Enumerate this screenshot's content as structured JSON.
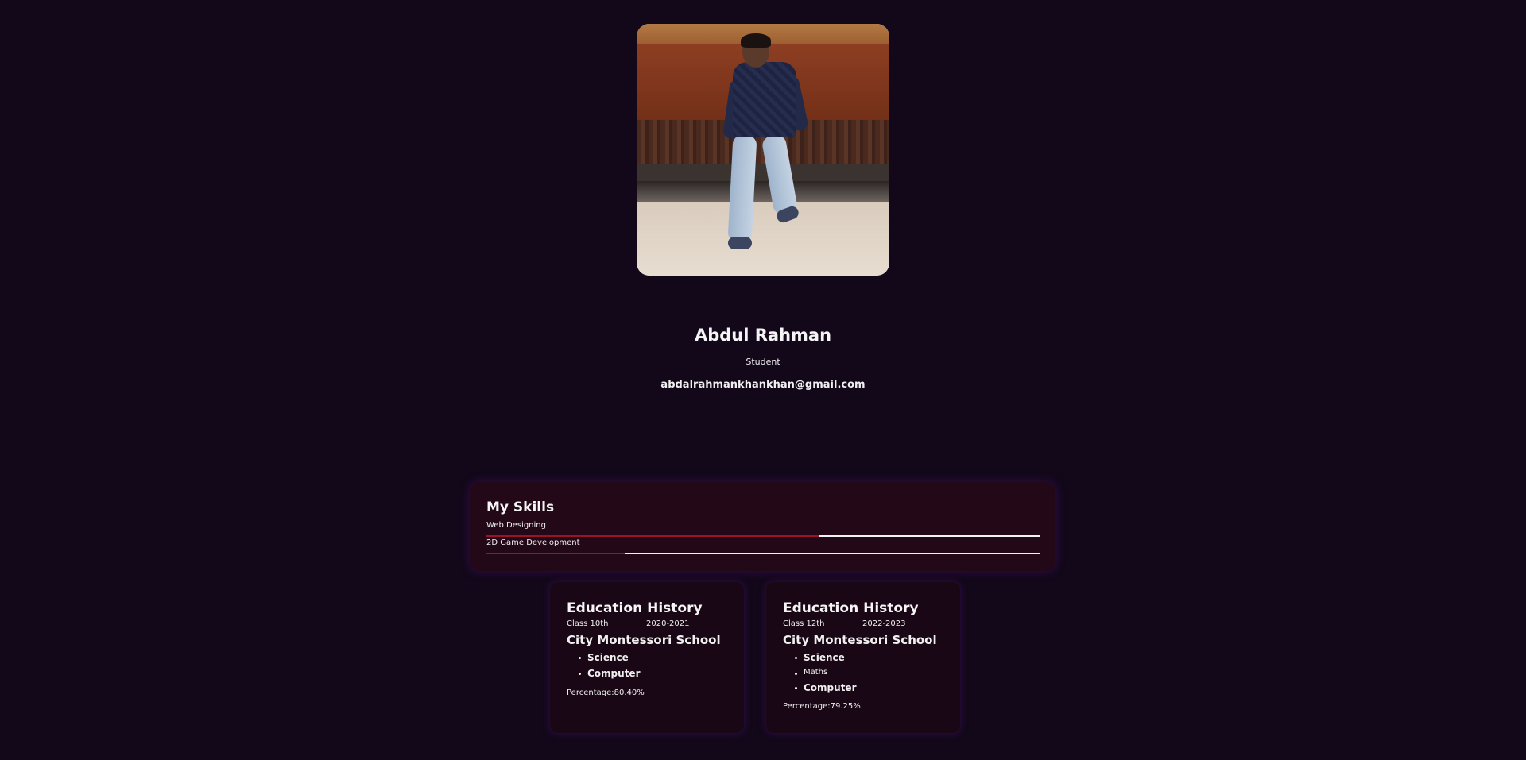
{
  "profile": {
    "name": "Abdul Rahman",
    "role": "Student",
    "email": "abdalrahmankhankhan@gmail.com"
  },
  "skills": {
    "title": "My Skills",
    "items": [
      {
        "label": "Web Designing",
        "level": 0.6
      },
      {
        "label": "2D Game Development",
        "level": 0.25
      }
    ]
  },
  "education": [
    {
      "title": "Education History",
      "class": "Class 10th",
      "years": "2020-2021",
      "school": "City Montessori School",
      "subjects": [
        "Science",
        "Computer"
      ],
      "percentage": "Percentage:80.40%"
    },
    {
      "title": "Education History",
      "class": "Class 12th",
      "years": "2022-2023",
      "school": "City Montessori School",
      "subjects": [
        "Science",
        "Maths",
        "Computer"
      ],
      "percentage": "Percentage:79.25%"
    }
  ],
  "colors": {
    "background": "#13081a",
    "card": "#230817",
    "bar_fill": "#9a1228",
    "bar_track": "#f2f2f2"
  }
}
